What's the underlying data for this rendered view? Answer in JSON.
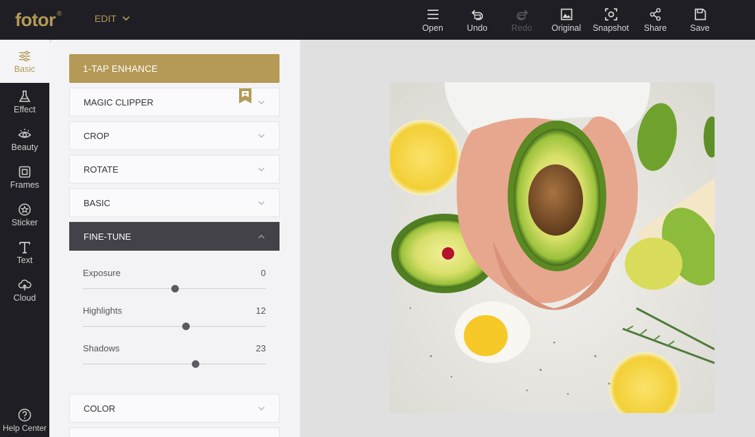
{
  "brand": {
    "name": "fotor",
    "mark": "®"
  },
  "header": {
    "menu_label": "EDIT",
    "tools": [
      {
        "label": "Open",
        "icon": "menu-icon",
        "enabled": true
      },
      {
        "label": "Undo",
        "icon": "undo-icon",
        "enabled": true
      },
      {
        "label": "Redo",
        "icon": "redo-icon",
        "enabled": false
      },
      {
        "label": "Original",
        "icon": "image-icon",
        "enabled": true
      },
      {
        "label": "Snapshot",
        "icon": "snapshot-icon",
        "enabled": true
      },
      {
        "label": "Share",
        "icon": "share-icon",
        "enabled": true
      },
      {
        "label": "Save",
        "icon": "save-icon",
        "enabled": true
      }
    ]
  },
  "sidebar": {
    "items": [
      {
        "label": "Basic",
        "icon": "sliders-icon",
        "active": true
      },
      {
        "label": "Effect",
        "icon": "flask-icon",
        "active": false
      },
      {
        "label": "Beauty",
        "icon": "eye-icon",
        "active": false
      },
      {
        "label": "Frames",
        "icon": "frame-icon",
        "active": false
      },
      {
        "label": "Sticker",
        "icon": "star-badge-icon",
        "active": false
      },
      {
        "label": "Text",
        "icon": "text-icon",
        "active": false
      },
      {
        "label": "Cloud",
        "icon": "cloud-icon",
        "active": false
      }
    ],
    "help_label": "Help Center"
  },
  "panel": {
    "enhance_label": "1-TAP ENHANCE",
    "sections": {
      "magic_clipper": "MAGIC CLIPPER",
      "crop": "CROP",
      "rotate": "ROTATE",
      "basic": "BASIC",
      "fine_tune": "FINE-TUNE",
      "color": "COLOR"
    },
    "fine_tune": {
      "exposure": {
        "label": "Exposure",
        "value": "0"
      },
      "highlights": {
        "label": "Highlights",
        "value": "12"
      },
      "shadows": {
        "label": "Shadows",
        "value": "23"
      }
    }
  },
  "colors": {
    "accent": "#b49a56",
    "topbar": "#1e1e24",
    "active_section": "#424248"
  }
}
